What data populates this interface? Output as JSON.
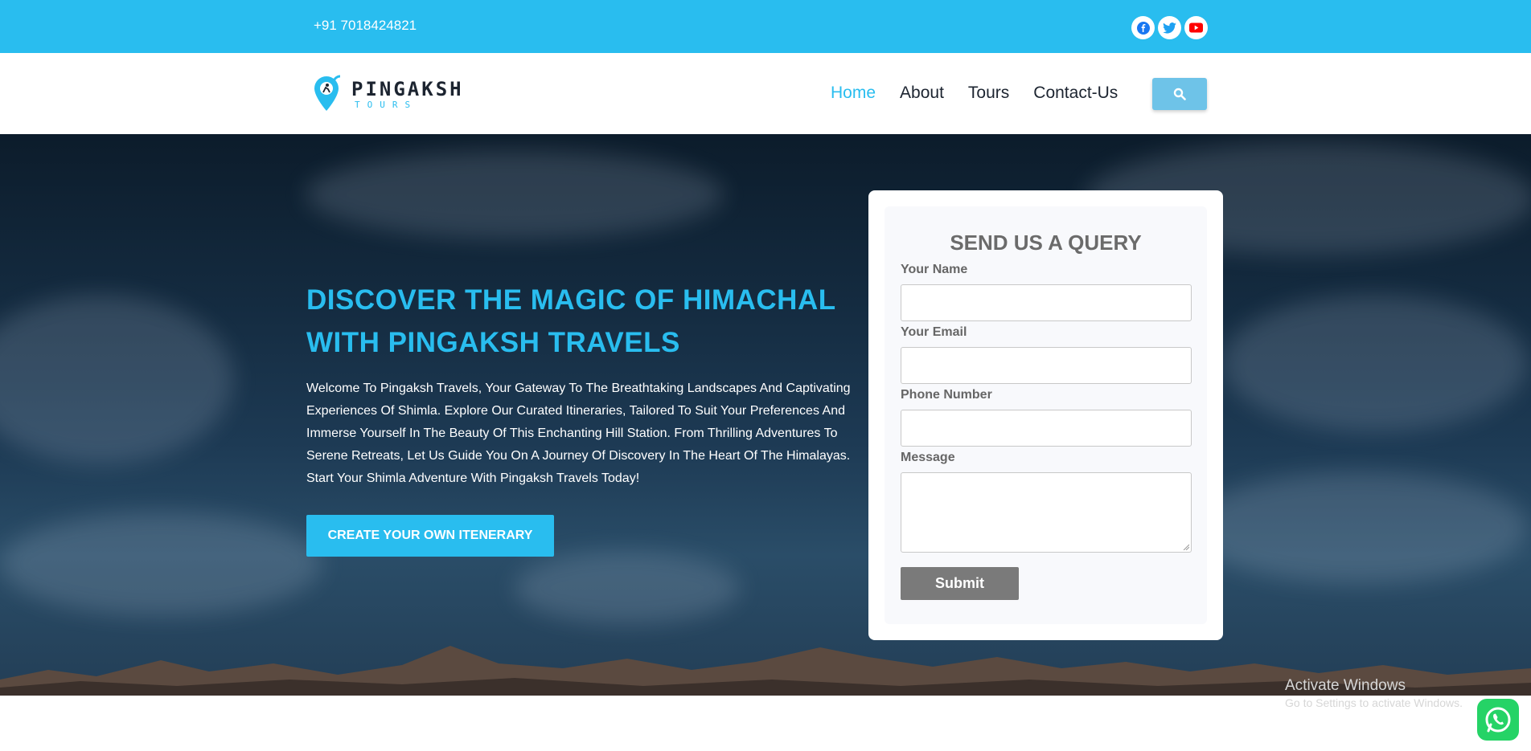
{
  "topbar": {
    "phone": "+91 7018424821"
  },
  "socials": [
    {
      "icon": "facebook-icon",
      "color": "#1877f2"
    },
    {
      "icon": "twitter-icon",
      "color": "#1da1f2"
    },
    {
      "icon": "youtube-icon",
      "color": "#ff0000"
    }
  ],
  "brand": {
    "name": "PINGAKSH",
    "sub": "TOURS",
    "accent": "#29bdef"
  },
  "nav": {
    "items": [
      "Home",
      "About",
      "Tours",
      "Contact-Us"
    ],
    "active": "Home"
  },
  "hero": {
    "title_line1": "DISCOVER THE MAGIC OF HIMACHAL",
    "title_line2": "WITH PINGAKSH TRAVELS",
    "text": "Welcome To Pingaksh Travels, Your Gateway To The Breathtaking Landscapes And Captivating Experiences Of Shimla. Explore Our Curated Itineraries, Tailored To Suit Your Preferences And Immerse Yourself In The Beauty Of This Enchanting Hill Station. From Thrilling Adventures To Serene Retreats, Let Us Guide You On A Journey Of Discovery In The Heart Of The Himalayas. Start Your Shimla Adventure With Pingaksh Travels Today!",
    "cta": "CREATE YOUR OWN ITENERARY"
  },
  "form": {
    "title": "SEND US A QUERY",
    "name_label": "Your Name",
    "email_label": "Your Email",
    "phone_label": "Phone Number",
    "message_label": "Message",
    "submit": "Submit"
  },
  "watermark": {
    "line1": "Activate Windows",
    "line2": "Go to Settings to activate Windows."
  }
}
